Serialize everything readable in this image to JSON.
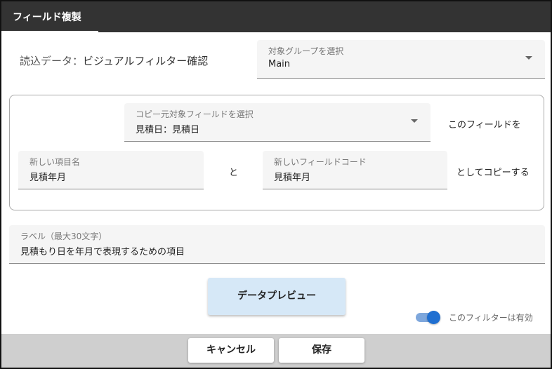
{
  "dialog": {
    "title": "フィールド複製"
  },
  "source": {
    "label_prefix": "読込データ：",
    "label_value": "ビジュアルフィルター確認"
  },
  "group_select": {
    "label": "対象グループを選択",
    "value": "Main"
  },
  "copy_field_select": {
    "label": "コピー元対象フィールドを選択",
    "value": "見積日：見積日"
  },
  "copy_text": {
    "this_field": "このフィールドを",
    "and": "と",
    "copy_as": "としてコピーする"
  },
  "new_item_name": {
    "label": "新しい項目名",
    "value": "見積年月"
  },
  "new_field_code": {
    "label": "新しいフィールドコード",
    "value": "見積年月"
  },
  "label_field": {
    "label": "ラベル（最大30文字）",
    "value": "見積もり日を年月で表現するための項目"
  },
  "preview_button": "データプレビュー",
  "filter_toggle": {
    "label": "このフィルターは有効",
    "enabled": true
  },
  "footer": {
    "cancel": "キャンセル",
    "save": "保存"
  }
}
